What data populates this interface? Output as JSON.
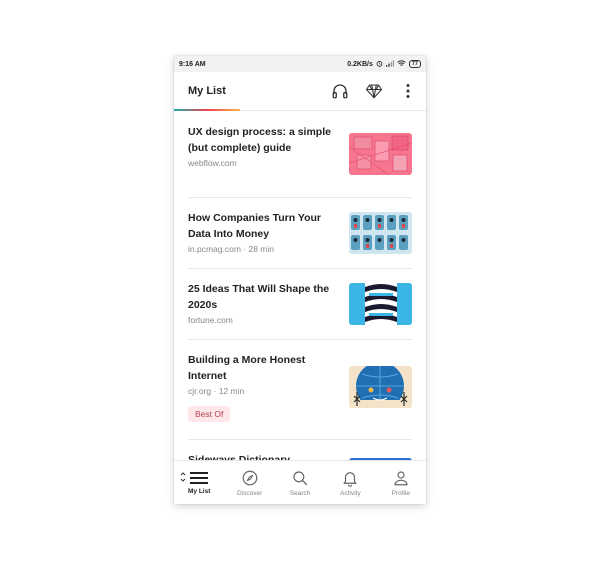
{
  "status_bar": {
    "time": "9:16 AM",
    "network_speed": "0.2KB/s",
    "battery": "77",
    "icons": [
      "alarm-icon",
      "signal-icon",
      "wifi-icon",
      "battery-icon"
    ]
  },
  "header": {
    "title": "My List",
    "actions": [
      "headphones-icon",
      "diamond-icon",
      "more-vertical-icon"
    ]
  },
  "articles": [
    {
      "title": "UX design process: a simple (but complete) guide",
      "meta": "webflow.com"
    },
    {
      "title": "How Companies Turn Your Data Into Money",
      "meta": "in.pcmag.com · 28 min"
    },
    {
      "title": "25 Ideas That Will Shape the 2020s",
      "meta": "fortune.com"
    },
    {
      "title": "Building a More Honest Internet",
      "meta": "cjr.org · 12 min",
      "badge": "Best Of"
    },
    {
      "title": "Sideways Dictionary",
      "meta": ""
    }
  ],
  "bottom_nav": [
    {
      "label": "My List",
      "icon": "list-icon",
      "active": true
    },
    {
      "label": "Discover",
      "icon": "compass-icon",
      "active": false
    },
    {
      "label": "Search",
      "icon": "search-icon",
      "active": false
    },
    {
      "label": "Activity",
      "icon": "bell-icon",
      "active": false
    },
    {
      "label": "Profile",
      "icon": "person-icon",
      "active": false
    }
  ],
  "colors": {
    "accent_gradient": [
      "#1cb0a8",
      "#ef4056",
      "#fcb643"
    ],
    "badge_bg": "#fde7e9",
    "badge_text": "#b34150"
  }
}
